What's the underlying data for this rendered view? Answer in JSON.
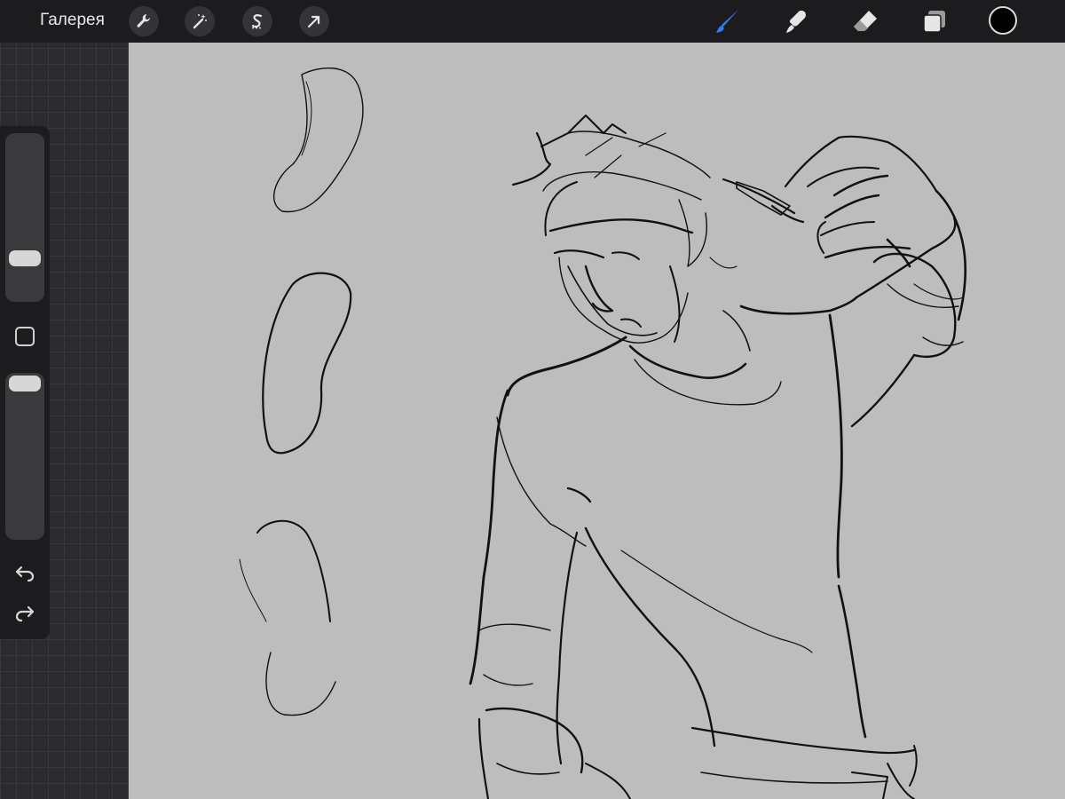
{
  "topbar": {
    "gallery_label": "Галерея",
    "left_tools": [
      {
        "name": "actions-wrench-icon"
      },
      {
        "name": "adjustments-magic-wand-icon"
      },
      {
        "name": "selection-s-icon"
      },
      {
        "name": "transform-arrow-icon"
      }
    ],
    "right_tools": [
      {
        "name": "brush-icon",
        "active": true,
        "color": "#2f7cf6"
      },
      {
        "name": "smudge-icon",
        "active": false
      },
      {
        "name": "eraser-icon",
        "active": false
      },
      {
        "name": "layers-icon",
        "active": false
      }
    ],
    "current_color": "#000000"
  },
  "sidebar": {
    "brush_size_level": 0.25,
    "opacity_level": 0.95,
    "modify_icon": "square-icon",
    "undo_icon": "undo-arrow-icon",
    "redo_icon": "redo-arrow-icon"
  },
  "canvas": {
    "background_color": "#bdbdbd",
    "content": "sketch-drawing"
  }
}
